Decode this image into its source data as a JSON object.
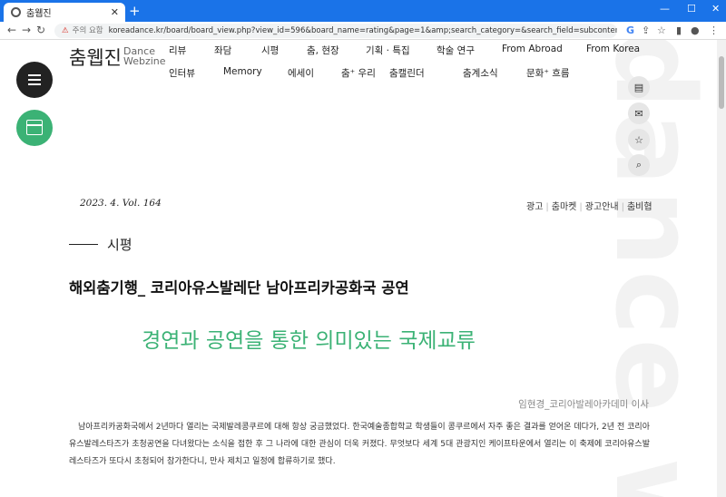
{
  "browser": {
    "tab_title": "춤웹진",
    "tab_close": "✕",
    "new_tab": "+",
    "security_label": "주의 요함",
    "url": "koreadance.kr/board/board_view.php?view_id=596&board_name=rating&page=1&amp;search_category=&search_field=subcontents&search_text=코리아유스..."
  },
  "site": {
    "logo_kr": "춤웹진",
    "logo_en_1": "Dance",
    "logo_en_2": "Webzine",
    "watermark": "dance webzine",
    "nav_row1": [
      "리뷰",
      "좌담",
      "시평",
      "춤, 현장",
      "기획 · 특집",
      "학술 연구",
      "From Abroad",
      "From Korea"
    ],
    "nav_row2": [
      "인터뷰",
      "Memory",
      "에세이",
      "춤⁺ 우리",
      "춤캘린더",
      "춤계소식",
      "문화⁺ 흐름"
    ]
  },
  "issue": "2023. 4.  Vol. 164",
  "top_links": [
    "광고",
    "춤마켓",
    "광고안내",
    "춤비협"
  ],
  "section": "시평",
  "headline": "해외춤기행_ 코리아유스발레단 남아프리카공화국 공연",
  "subhead": "경연과 공연을 통한 의미있는 국제교류",
  "author": "임현경_코리아발레아카데미 이사",
  "body": "남아프리카공화국에서 2년마다 열리는 국제발레콩쿠르에 대해 항상 궁금했었다. 한국예술종합학교 학생들이 콩쿠르에서 자주 좋은 결과를 얻어온 데다가, 2년 전 코리아유스발레스타즈가 초청공연을 다녀왔다는 소식을 접한 후 그 나라에 대한 관심이 더욱 커졌다. 무엇보다 세계 5대 관광지인 케이프타운에서 열리는 이 축제에 코리아유스발레스타즈가 또다시 초청되어 참가한다니, 만사 제치고 일정에 합류하기로 했다.",
  "colors": {
    "accent": "#3bb275",
    "browser_bar": "#1a73e8"
  },
  "icons": [
    "hamburger-menu-icon",
    "calendar-icon",
    "list-icon",
    "mail-icon",
    "star-icon",
    "search-icon"
  ]
}
